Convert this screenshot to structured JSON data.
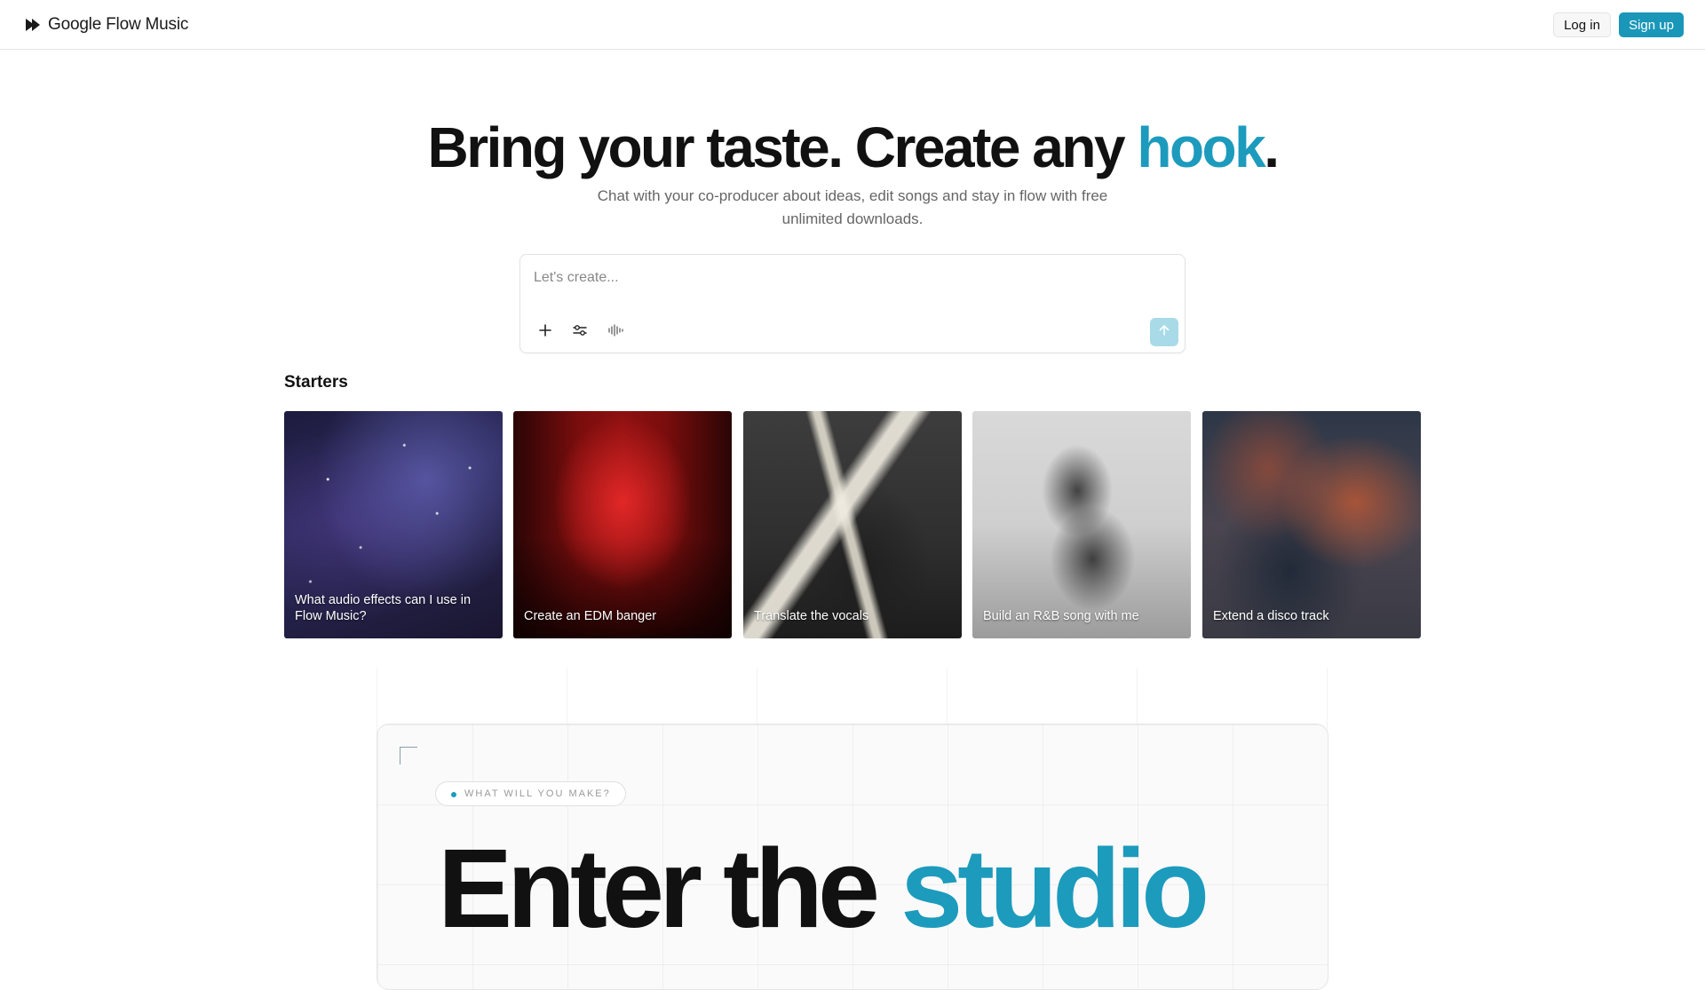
{
  "header": {
    "brand_name": "Google Flow Music",
    "login_label": "Log in",
    "signup_label": "Sign up"
  },
  "hero": {
    "title_main": "Bring your taste. Create any ",
    "title_accent": "hook",
    "title_end": ".",
    "subtitle": "Chat with your co-producer about ideas, edit songs and stay in flow with free unlimited downloads."
  },
  "prompt": {
    "placeholder": "Let's create...",
    "tools": [
      "plus-icon",
      "sliders-icon",
      "waveform-icon"
    ],
    "send_icon": "arrow-up-icon"
  },
  "starters": {
    "title": "Starters",
    "items": [
      {
        "label": "What audio effects can I use in Flow Music?"
      },
      {
        "label": "Create an EDM banger"
      },
      {
        "label": "Translate the vocals"
      },
      {
        "label": "Build an R&B song with me"
      },
      {
        "label": "Extend a disco track"
      }
    ]
  },
  "studio": {
    "pill_label": "WHAT WILL YOU MAKE?",
    "title_main": "Enter the ",
    "title_accent": "studio"
  },
  "colors": {
    "accent": "#1c9bbd",
    "signup_bg": "#1a97b8",
    "send_bg": "#a8dbe7"
  }
}
